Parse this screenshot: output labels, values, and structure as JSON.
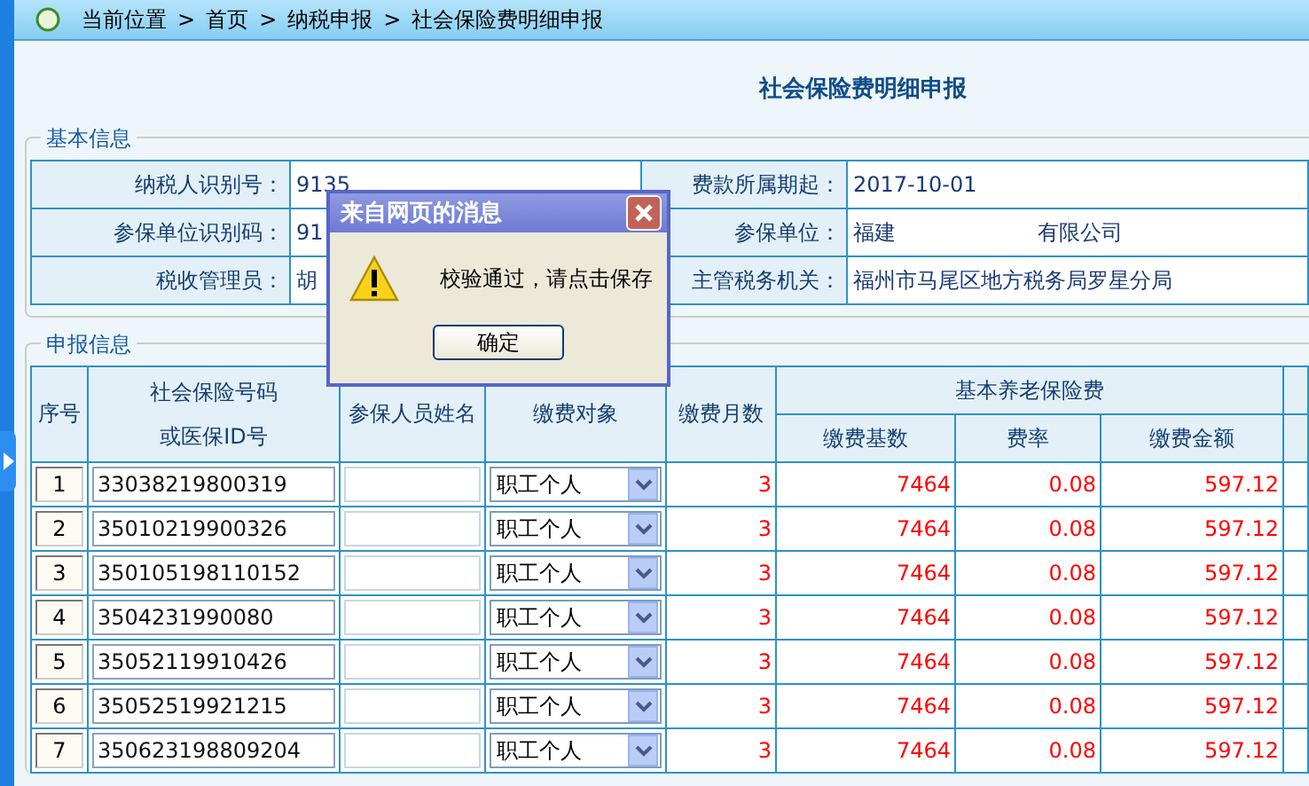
{
  "breadcrumb": {
    "label": "当前位置",
    "separator": ">",
    "items": [
      "首页",
      "纳税申报",
      "社会保险费明细申报"
    ]
  },
  "page_title": "社会保险费明细申报",
  "basic_info": {
    "legend": "基本信息",
    "rows": [
      [
        {
          "label": "纳税人识别号：",
          "value": "9135"
        },
        {
          "label": "费款所属期起：",
          "value": "2017-10-01"
        }
      ],
      [
        {
          "label": "参保单位识别码：",
          "value": "91"
        },
        {
          "label": "参保单位：",
          "value": "福建",
          "value_tail": "有限公司"
        }
      ],
      [
        {
          "label": "税收管理员：",
          "value": "胡"
        },
        {
          "label": "主管税务机关：",
          "value": "福州市马尾区地方税务局罗星分局"
        }
      ]
    ]
  },
  "declaration": {
    "legend": "申报信息",
    "headers": {
      "index": "序号",
      "id_line1": "社会保险号码",
      "id_line2": "或医保ID号",
      "name": "参保人员姓名",
      "target": "缴费对象",
      "months": "缴费月数",
      "group": "基本养老保险费",
      "base": "缴费基数",
      "rate": "费率",
      "amount": "缴费金额"
    },
    "rows": [
      {
        "index": "1",
        "id": "33038219800319",
        "target": "职工个人",
        "months": "3",
        "base": "7464",
        "rate": "0.08",
        "amount": "597.12"
      },
      {
        "index": "2",
        "id": "35010219900326",
        "target": "职工个人",
        "months": "3",
        "base": "7464",
        "rate": "0.08",
        "amount": "597.12"
      },
      {
        "index": "3",
        "id": "350105198110152",
        "target": "职工个人",
        "months": "3",
        "base": "7464",
        "rate": "0.08",
        "amount": "597.12"
      },
      {
        "index": "4",
        "id": "3504231990080",
        "target": "职工个人",
        "months": "3",
        "base": "7464",
        "rate": "0.08",
        "amount": "597.12"
      },
      {
        "index": "5",
        "id": "35052119910426",
        "target": "职工个人",
        "months": "3",
        "base": "7464",
        "rate": "0.08",
        "amount": "597.12"
      },
      {
        "index": "6",
        "id": "35052519921215",
        "target": "职工个人",
        "months": "3",
        "base": "7464",
        "rate": "0.08",
        "amount": "597.12"
      },
      {
        "index": "7",
        "id": "350623198809204",
        "target": "职工个人",
        "months": "3",
        "base": "7464",
        "rate": "0.08",
        "amount": "597.12"
      }
    ]
  },
  "dialog": {
    "title": "来自网页的消息",
    "message": "校验通过，请点击保存",
    "button": "确定"
  }
}
